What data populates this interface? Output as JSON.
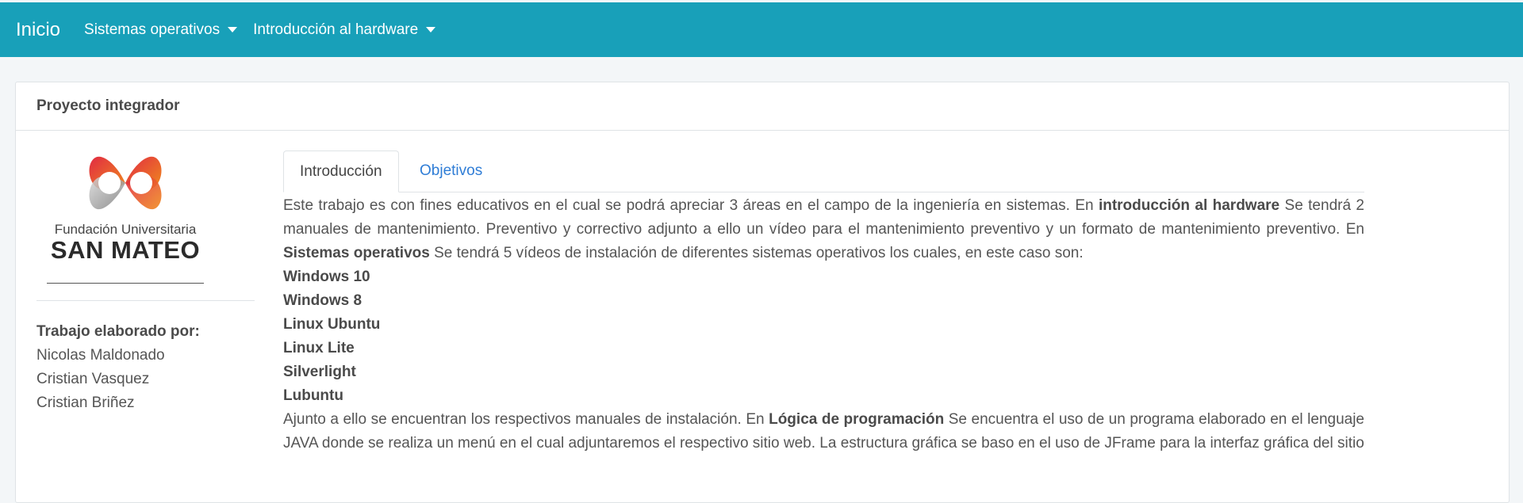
{
  "navbar": {
    "brand": "Inicio",
    "items": [
      {
        "label": "Sistemas operativos"
      },
      {
        "label": "Introducción al hardware"
      }
    ],
    "color": "#18a0b9"
  },
  "card": {
    "title": "Proyecto integrador"
  },
  "logo": {
    "line1": "Fundación Universitaria",
    "line2": "SAN MATEO"
  },
  "authors": {
    "heading": "Trabajo elaborado por:",
    "names": [
      "Nicolas Maldonado",
      "Cristian Vasquez",
      "Cristian Briñez"
    ]
  },
  "tabs": [
    {
      "label": "Introducción",
      "active": true
    },
    {
      "label": "Objetivos",
      "active": false
    }
  ],
  "intro": {
    "p1_a": "Este trabajo es con fines educativos en el cual se podrá apreciar 3 áreas en el campo de la ingeniería en sistemas. En ",
    "p1_b": "introducción al hardware",
    "p1_c": " Se tendrá 2 manuales de mantenimiento. Preventivo y correctivo adjunto a ello un vídeo para el mantenimiento preventivo y un formato de mantenimiento preventivo. En ",
    "p1_d": "Sistemas operativos",
    "p1_e": " Se tendrá 5 vídeos de instalación de diferentes sistemas operativos los cuales, en este caso son:",
    "os_list": [
      "Windows 10",
      "Windows 8",
      "Linux Ubuntu",
      "Linux Lite",
      "Silverlight",
      "Lubuntu"
    ],
    "p2_a": "Ajunto a ello se encuentran los respectivos manuales de instalación. En ",
    "p2_b": "Lógica de programación",
    "p2_c": " Se encuentra el uso de un programa elaborado en el lenguaje JAVA donde se realiza un menú en el cual adjuntaremos el respectivo sitio web. La estructura gráfica se baso en el uso de JFrame para la interfaz gráfica del sitio"
  }
}
